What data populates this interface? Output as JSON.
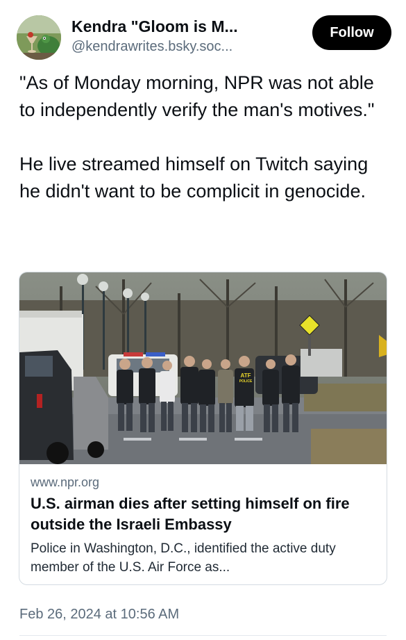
{
  "author": {
    "display_name": "Kendra \"Gloom is M...",
    "handle": "@kendrawrites.bsky.soc..."
  },
  "header": {
    "follow_label": "Follow"
  },
  "post": {
    "paragraphs": [
      "\"As of Monday morning, NPR was not able to independently verify the man's motives.\"",
      "He live streamed himself on Twitch saying he didn't want to be complicit in genocide."
    ]
  },
  "link_card": {
    "domain": "www.npr.org",
    "title": "U.S. airman dies after setting himself on fire outside the Israeli Embassy",
    "description": "Police in Washington, D.C., identified the active duty member of the U.S. Air Force as...",
    "image_labels": {
      "vest_text": "ATF",
      "vest_subtext": "POLICE"
    }
  },
  "meta": {
    "timestamp": "Feb 26, 2024 at 10:56 AM"
  }
}
